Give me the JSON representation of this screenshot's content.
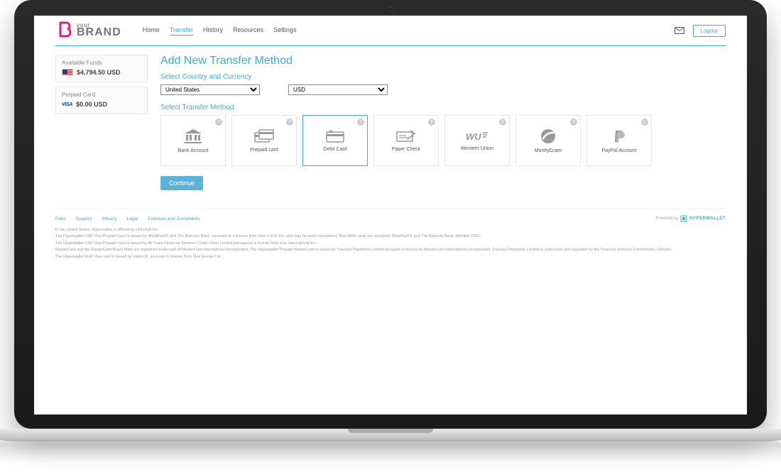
{
  "brand": {
    "tagline": "your",
    "name": "BRAND"
  },
  "nav": [
    "Home",
    "Transfer",
    "History",
    "Resources",
    "Settings"
  ],
  "nav_active": 1,
  "logout": "Logout",
  "sidebar": {
    "funds": {
      "title": "Available Funds",
      "amount": "$4,794.50 USD"
    },
    "prepaid": {
      "title": "Prepaid Card",
      "brand": "VISA",
      "amount": "$0.00 USD"
    }
  },
  "page": {
    "title": "Add New Transfer Method",
    "section1": "Select Country and Currency",
    "country": "United States",
    "currency": "USD",
    "section2": "Select Transfer Method",
    "continue": "Continue"
  },
  "methods": [
    {
      "id": "bank-account",
      "label": "Bank Account",
      "selected": false
    },
    {
      "id": "prepaid-card",
      "label": "Prepaid card",
      "selected": false
    },
    {
      "id": "debit-card",
      "label": "Debit Card",
      "selected": true
    },
    {
      "id": "paper-check",
      "label": "Paper Check",
      "selected": false
    },
    {
      "id": "western-union",
      "label": "Western Union",
      "selected": false
    },
    {
      "id": "moneygram",
      "label": "MoneyGram",
      "selected": false
    },
    {
      "id": "paypal",
      "label": "PayPal Account",
      "selected": false
    }
  ],
  "footer": {
    "links": [
      "Fees",
      "Support",
      "Privacy",
      "Legal",
      "Licenses and Complaints"
    ],
    "powered_prefix": "Powered by",
    "powered_brand": "HYPERWALLET",
    "disclaimer": [
      "In the United States, Hyperwallet is offered by HSI USA Inc.",
      "The Hyperwallet USD Visa Prepaid Card is issued by MetaBank® and The Bancorp Bank, pursuant to a license from Visa U.S.A. Inc. and may be used everywhere Visa debit cards are accepted. MetaBank® and The Bancorp Bank; Member FDIC.",
      "The Hyperwallet CAD Visa Prepaid Card is issued by All Trans Financial Services Credit Union Limited pursuant to a license from Visa International Inc.",
      "MasterCard and the MasterCard Brand Mark are registered trademark of MasterCard International Incorporated. The Hyperwallet Prepaid MasterCard is issued by Transact Payments Limited pursuant to licence by MasterCard International Incorporated. Transact Payments Limited is authorised and regulated by the Financial Services Commission, Gibraltar",
      "The Hyperwallet EUR Visa card is issued by Valitor hf. pursuant to license from Visa Europe Ltd."
    ]
  }
}
